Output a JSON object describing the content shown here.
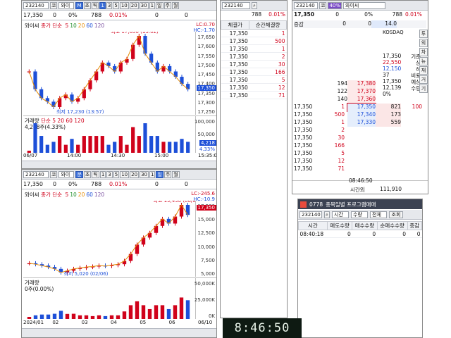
{
  "top_chart": {
    "code": "232140",
    "tab_label": "코",
    "name_short": "와이",
    "period_buttons": [
      "M",
      "초",
      "틱",
      "1",
      "3",
      "5",
      "10",
      "20",
      "30",
      "1",
      "일",
      "주",
      "월"
    ],
    "price": "17,350",
    "change": "0",
    "change_pct": "0%",
    "volume": "788",
    "vol_pct": "0.01%",
    "val1": "0",
    "val2": "0",
    "stock_name": "와이씨",
    "ma_legend_label": "종가 단순",
    "ma_periods": [
      "5",
      "10",
      "20",
      "60",
      "120"
    ],
    "lc_label": "LC:0.70",
    "hc_label": "HC:-1.70",
    "high_label": "최고 17,650 (15:02)",
    "low_label": "최저 17,230 (13:57)",
    "price_ticks": [
      "17,650",
      "17,600",
      "17,550",
      "17,500",
      "17,450",
      "17,400",
      "17,350",
      "17,300",
      "17,250"
    ],
    "current_tag": "17,350",
    "vol_title": "거래량",
    "vol_ma": "단순 5 20 60 120",
    "vol_value": "4,218주(4.33%)",
    "vol_ticks": [
      "100,000",
      "50,000"
    ],
    "vol_tag": "4,218",
    "vol_tag2": "4.33%",
    "time_labels": [
      "06/07",
      "14:00",
      "14:30",
      "15:00",
      "15:35:00"
    ]
  },
  "bottom_chart": {
    "code": "232140",
    "tab_label": "코",
    "name_short": "와이",
    "period_buttons": [
      "분",
      "초",
      "틱",
      "1",
      "3",
      "5",
      "10",
      "20",
      "30",
      "1",
      "일",
      "주",
      "월"
    ],
    "price": "17,350",
    "change": "0",
    "change_pct": "0%",
    "volume": "788",
    "vol_pct": "0.01%",
    "val1": "0",
    "val2": "0",
    "stock_name": "와이씨",
    "ma_legend_label": "종가 단순",
    "ma_periods": [
      "5",
      "10",
      "20",
      "60",
      "120"
    ],
    "lc_label": "LC:-245.6",
    "hc_label": "HC:-10.9",
    "high_label": "최고 19,490 (06/05)",
    "low_label": "최저 5,020 (02/06)",
    "price_ticks": [
      "17,500",
      "15,000",
      "12,500",
      "10,000",
      "7,500",
      "5,000"
    ],
    "current_tag": "17,350",
    "vol_title": "거래량",
    "vol_value": "0주(0.00%)",
    "vol_ticks": [
      "50,000K",
      "25,000K",
      "0K"
    ],
    "time_labels": [
      "2024/01",
      "02",
      "03",
      "04",
      "05",
      "06",
      "06/10"
    ]
  },
  "trades": {
    "code": "232140",
    "volume": "788",
    "vol_pct": "0.01%",
    "headers": [
      "체결가",
      "순간체결량"
    ],
    "rows": [
      {
        "price": "17,350",
        "qty": "1"
      },
      {
        "price": "17,350",
        "qty": "500"
      },
      {
        "price": "17,350",
        "qty": "1"
      },
      {
        "price": "17,350",
        "qty": "2"
      },
      {
        "price": "17,350",
        "qty": "30"
      },
      {
        "price": "17,350",
        "qty": "166"
      },
      {
        "price": "17,350",
        "qty": "5"
      },
      {
        "price": "17,350",
        "qty": "12"
      },
      {
        "price": "17,350",
        "qty": "71"
      }
    ]
  },
  "orderbook": {
    "code": "232140",
    "tab_label": "코",
    "pct_badge": "40%",
    "stock_name": "와이씨",
    "price": "17,350",
    "change": "0",
    "change_pct": "0%",
    "volume": "788",
    "vol_pct": "0.01%",
    "label_change": "증감",
    "val_zero1": "0",
    "val_zero2": "0",
    "val_center": "14.0",
    "market": "KOSDAQ",
    "side_labels": [
      "시",
      "고",
      "저",
      "기준",
      "상",
      "하",
      "비용",
      "예상",
      "수량"
    ],
    "info_lines": [
      {
        "v": "17,350",
        "k": "기준",
        "cls": ""
      },
      {
        "v": "22,550",
        "k": "상",
        "cls": "up"
      },
      {
        "v": "12,150",
        "k": "하",
        "cls": "down"
      },
      {
        "v": "37",
        "k": "비용",
        "cls": ""
      },
      {
        "v": "17,350",
        "k": "예상",
        "cls": ""
      },
      {
        "v": "12,139",
        "k": "수량",
        "cls": ""
      },
      {
        "v": "0%",
        "k": "",
        "cls": ""
      }
    ],
    "vertical_tabs": [
      "투",
      "외",
      "차",
      "뉴",
      "재",
      "거",
      "기"
    ],
    "asks": [
      {
        "qty": "194",
        "price": "17,380"
      },
      {
        "qty": "122",
        "price": "17,370"
      },
      {
        "qty": "140",
        "price": "17,360"
      }
    ],
    "bids": [
      {
        "price": "17,350",
        "qty": "821"
      },
      {
        "price": "17,340",
        "qty": "173"
      },
      {
        "price": "17,330",
        "qty": "559"
      }
    ],
    "bid_side_pct": "100",
    "left_trades": [
      {
        "price": "17,350",
        "qty": "1"
      },
      {
        "price": "17,350",
        "qty": "500"
      },
      {
        "price": "17,350",
        "qty": "1"
      },
      {
        "price": "17,350",
        "qty": "2"
      },
      {
        "price": "17,350",
        "qty": "30"
      },
      {
        "price": "17,350",
        "qty": "166"
      },
      {
        "price": "17,350",
        "qty": "5"
      },
      {
        "price": "17,350",
        "qty": "12"
      },
      {
        "price": "17,350",
        "qty": "71"
      }
    ],
    "footer_time": "08:46:50",
    "footer_label": "시간외",
    "footer_total": "111,910"
  },
  "program": {
    "window_number": "0778",
    "window_title": "종목일별 프로그램매매",
    "code": "232140",
    "sel_time": "시간",
    "sel_qty": "수량",
    "sel_all": "전체",
    "query_button": "조회",
    "headers": [
      "시간",
      "매도수량",
      "매수수량",
      "순매수수량",
      "증감"
    ],
    "rows": [
      {
        "time": "08:40:18",
        "sell": "0",
        "buy": "0",
        "net": "0",
        "diff": "0"
      }
    ]
  },
  "clock": "8:46:50",
  "colors": {
    "up": "#d0021b",
    "down": "#1d4fd8",
    "accent": "#3a6ed8"
  },
  "chart_data": [
    {
      "type": "candlestick",
      "title": "와이씨",
      "series": [
        {
          "name": "종가 단순",
          "values": [
            17450,
            17350,
            17300,
            17280,
            17250,
            17300,
            17320,
            17280,
            17300,
            17350,
            17400,
            17450,
            17500,
            17480,
            17450,
            17500,
            17520,
            17600,
            17650,
            17550,
            17500,
            17450,
            17480,
            17450,
            17420,
            17380,
            17350
          ]
        }
      ],
      "ylim": [
        17230,
        17650
      ]
    },
    {
      "type": "candlestick",
      "title": "와이씨",
      "series": [
        {
          "name": "종가 단순",
          "values": [
            7000,
            6800,
            6500,
            6200,
            5800,
            5020,
            5400,
            5800,
            6000,
            6200,
            6300,
            6500,
            6400,
            6600,
            6800,
            7500,
            9000,
            11000,
            12500,
            13500,
            15000,
            16500,
            15500,
            17000,
            19490,
            17350
          ]
        }
      ],
      "ylim": [
        5020,
        19490
      ]
    }
  ]
}
